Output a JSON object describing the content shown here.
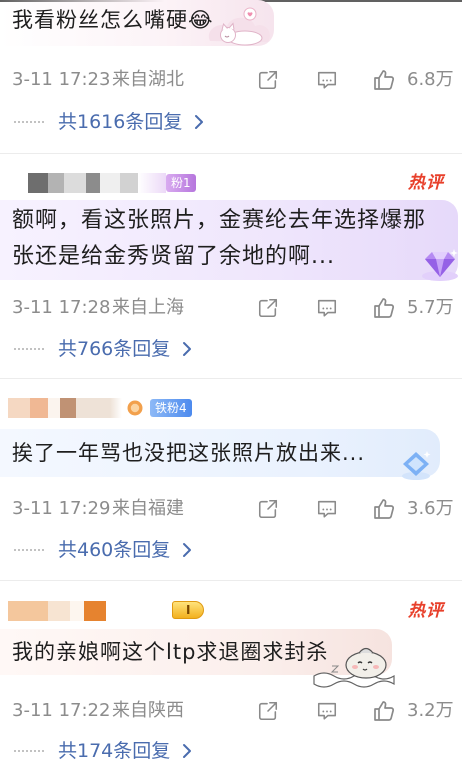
{
  "comments": [
    {
      "text": "我看粉丝怎么嘴硬😂",
      "sticker": "cat-cloud-sticker",
      "time": "3-11 17:23",
      "location": "来自湖北",
      "likes": "6.8万",
      "replies": "共1616条回复"
    },
    {
      "user_badge": "粉1",
      "hot_label": "热评",
      "text_lines": [
        "额啊，看这张照片，金赛纶去年选择爆那",
        "张还是给金秀贤留了余地的啊..."
      ],
      "sticker": "purple-diamond-sticker",
      "time": "3-11 17:28",
      "location": "来自上海",
      "likes": "5.7万",
      "replies": "共766条回复"
    },
    {
      "user_badge": "铁粉4",
      "text": "挨了一年骂也没把这张照片放出来...",
      "sticker": "blue-diamond-sticker",
      "time": "3-11 17:29",
      "location": "来自福建",
      "likes": "3.6万",
      "replies": "共460条回复"
    },
    {
      "user_badge": "I",
      "hot_label": "热评",
      "text": "我的亲娘啊这个ltp求退圈求封杀",
      "sticker": "sleeping-character-sticker",
      "time": "3-11 17:22",
      "location": "来自陕西",
      "likes": "3.2万",
      "replies": "共174条回复"
    }
  ],
  "icons": {
    "share": "share-icon",
    "comment": "comment-icon",
    "like": "thumbs-up-icon",
    "reply_more": "chevron-right-icon"
  },
  "colors": {
    "reply_link": "#4a6cae",
    "meta_text": "#8c8c8c",
    "hot_label": "#e8402b",
    "fan_badge": "#b676dd",
    "iron_fan_badge": "#4c8aee",
    "level_badge": "#f2b01e"
  }
}
